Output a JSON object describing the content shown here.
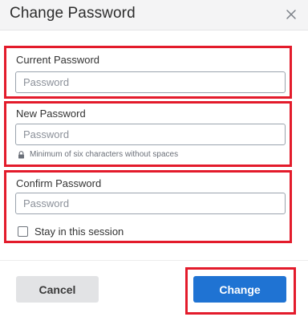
{
  "dialog": {
    "title": "Change Password",
    "close_icon": "close-icon"
  },
  "current_password": {
    "label": "Current Password",
    "placeholder": "Password",
    "value": ""
  },
  "new_password": {
    "label": "New Password",
    "placeholder": "Password",
    "value": "",
    "hint": "Minimum of six characters without spaces",
    "hint_icon": "lock-icon"
  },
  "confirm_password": {
    "label": "Confirm Password",
    "placeholder": "Password",
    "value": ""
  },
  "stay_in_session": {
    "label": "Stay in this session",
    "checked": false
  },
  "footer": {
    "cancel_label": "Cancel",
    "change_label": "Change"
  },
  "colors": {
    "primary": "#1f73d3",
    "highlight": "#e31b2b",
    "header_bg": "#f4f4f5",
    "cancel_bg": "#e2e3e5"
  }
}
